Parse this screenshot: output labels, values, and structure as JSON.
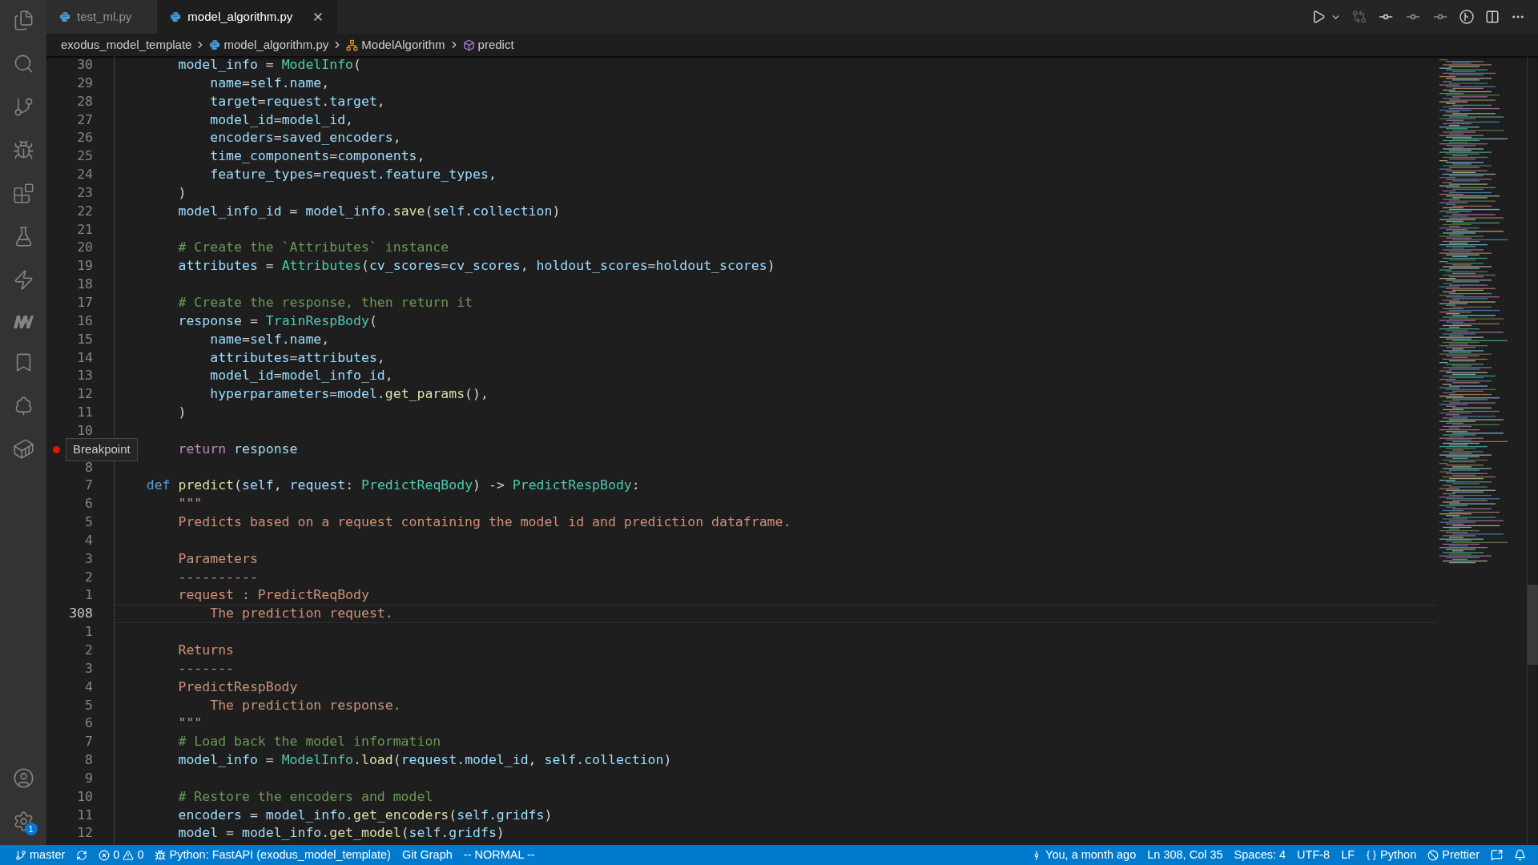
{
  "tabs": [
    {
      "label": "test_ml.py",
      "selected": false
    },
    {
      "label": "model_algorithm.py",
      "selected": true
    }
  ],
  "breadcrumbs": [
    {
      "kind": "folder",
      "label": "exodus_model_template"
    },
    {
      "kind": "file",
      "label": "model_algorithm.py"
    },
    {
      "kind": "class",
      "label": "ModelAlgorithm"
    },
    {
      "kind": "method",
      "label": "predict"
    }
  ],
  "activity_badge": "1",
  "tooltip": {
    "text": "Breakpoint"
  },
  "lines": [
    {
      "number": "30",
      "current": false,
      "breakpoint": false,
      "tokens": [
        {
          "kind": "var",
          "text": "        model_info"
        },
        {
          "kind": "punct",
          "text": " = "
        },
        {
          "kind": "class",
          "text": "ModelInfo"
        },
        {
          "kind": "punct",
          "text": "("
        }
      ]
    },
    {
      "number": "29",
      "current": false,
      "breakpoint": false,
      "tokens": [
        {
          "kind": "var",
          "text": "            name"
        },
        {
          "kind": "punct",
          "text": "="
        },
        {
          "kind": "var",
          "text": "self.name"
        },
        {
          "kind": "punct",
          "text": ","
        }
      ]
    },
    {
      "number": "28",
      "current": false,
      "breakpoint": false,
      "tokens": [
        {
          "kind": "var",
          "text": "            target"
        },
        {
          "kind": "punct",
          "text": "="
        },
        {
          "kind": "var",
          "text": "request.target"
        },
        {
          "kind": "punct",
          "text": ","
        }
      ]
    },
    {
      "number": "27",
      "current": false,
      "breakpoint": false,
      "tokens": [
        {
          "kind": "var",
          "text": "            model_id"
        },
        {
          "kind": "punct",
          "text": "="
        },
        {
          "kind": "var",
          "text": "model_id"
        },
        {
          "kind": "punct",
          "text": ","
        }
      ]
    },
    {
      "number": "26",
      "current": false,
      "breakpoint": false,
      "tokens": [
        {
          "kind": "var",
          "text": "            encoders"
        },
        {
          "kind": "punct",
          "text": "="
        },
        {
          "kind": "var",
          "text": "saved_encoders"
        },
        {
          "kind": "punct",
          "text": ","
        }
      ]
    },
    {
      "number": "25",
      "current": false,
      "breakpoint": false,
      "tokens": [
        {
          "kind": "var",
          "text": "            time_components"
        },
        {
          "kind": "punct",
          "text": "="
        },
        {
          "kind": "var",
          "text": "components"
        },
        {
          "kind": "punct",
          "text": ","
        }
      ]
    },
    {
      "number": "24",
      "current": false,
      "breakpoint": false,
      "tokens": [
        {
          "kind": "var",
          "text": "            feature_types"
        },
        {
          "kind": "punct",
          "text": "="
        },
        {
          "kind": "var",
          "text": "request.feature_types"
        },
        {
          "kind": "punct",
          "text": ","
        }
      ]
    },
    {
      "number": "23",
      "current": false,
      "breakpoint": false,
      "tokens": [
        {
          "kind": "punct",
          "text": "        )"
        }
      ]
    },
    {
      "number": "22",
      "current": false,
      "breakpoint": false,
      "tokens": [
        {
          "kind": "var",
          "text": "        model_info_id"
        },
        {
          "kind": "punct",
          "text": " = "
        },
        {
          "kind": "var",
          "text": "model_info."
        },
        {
          "kind": "func",
          "text": "save"
        },
        {
          "kind": "punct",
          "text": "("
        },
        {
          "kind": "var",
          "text": "self.collection"
        },
        {
          "kind": "punct",
          "text": ")"
        }
      ]
    },
    {
      "number": "21",
      "current": false,
      "breakpoint": false
    },
    {
      "number": "20",
      "current": false,
      "breakpoint": false,
      "tokens": [
        {
          "kind": "comment",
          "text": "        # Create the `Attributes` instance"
        }
      ]
    },
    {
      "number": "19",
      "current": false,
      "breakpoint": false,
      "tokens": [
        {
          "kind": "var",
          "text": "        attributes"
        },
        {
          "kind": "punct",
          "text": " = "
        },
        {
          "kind": "class",
          "text": "Attributes"
        },
        {
          "kind": "punct",
          "text": "("
        },
        {
          "kind": "var",
          "text": "cv_scores"
        },
        {
          "kind": "punct",
          "text": "="
        },
        {
          "kind": "var",
          "text": "cv_scores"
        },
        {
          "kind": "punct",
          "text": ", "
        },
        {
          "kind": "var",
          "text": "holdout_scores"
        },
        {
          "kind": "punct",
          "text": "="
        },
        {
          "kind": "var",
          "text": "holdout_scores"
        },
        {
          "kind": "punct",
          "text": ")"
        }
      ]
    },
    {
      "number": "18",
      "current": false,
      "breakpoint": false
    },
    {
      "number": "17",
      "current": false,
      "breakpoint": false,
      "tokens": [
        {
          "kind": "comment",
          "text": "        # Create the response, then return it"
        }
      ]
    },
    {
      "number": "16",
      "current": false,
      "breakpoint": false,
      "tokens": [
        {
          "kind": "var",
          "text": "        response"
        },
        {
          "kind": "punct",
          "text": " = "
        },
        {
          "kind": "class",
          "text": "TrainRespBody"
        },
        {
          "kind": "punct",
          "text": "("
        }
      ]
    },
    {
      "number": "15",
      "current": false,
      "breakpoint": false,
      "tokens": [
        {
          "kind": "var",
          "text": "            name"
        },
        {
          "kind": "punct",
          "text": "="
        },
        {
          "kind": "var",
          "text": "self.name"
        },
        {
          "kind": "punct",
          "text": ","
        }
      ]
    },
    {
      "number": "14",
      "current": false,
      "breakpoint": false,
      "tokens": [
        {
          "kind": "var",
          "text": "            attributes"
        },
        {
          "kind": "punct",
          "text": "="
        },
        {
          "kind": "var",
          "text": "attributes"
        },
        {
          "kind": "punct",
          "text": ","
        }
      ]
    },
    {
      "number": "13",
      "current": false,
      "breakpoint": false,
      "tokens": [
        {
          "kind": "var",
          "text": "            model_id"
        },
        {
          "kind": "punct",
          "text": "="
        },
        {
          "kind": "var",
          "text": "model_info_id"
        },
        {
          "kind": "punct",
          "text": ","
        }
      ]
    },
    {
      "number": "12",
      "current": false,
      "breakpoint": false,
      "tokens": [
        {
          "kind": "var",
          "text": "            hyperparameters"
        },
        {
          "kind": "punct",
          "text": "="
        },
        {
          "kind": "var",
          "text": "model."
        },
        {
          "kind": "func",
          "text": "get_params"
        },
        {
          "kind": "punct",
          "text": "(),"
        }
      ]
    },
    {
      "number": "11",
      "current": false,
      "breakpoint": false,
      "tokens": [
        {
          "kind": "punct",
          "text": "        )"
        }
      ]
    },
    {
      "number": "10",
      "current": false,
      "breakpoint": false
    },
    {
      "current": false,
      "breakpoint": true,
      "tokens": [
        {
          "kind": "control",
          "text": "        return"
        },
        {
          "kind": "var",
          "text": " response"
        }
      ]
    },
    {
      "number": "8",
      "current": false,
      "breakpoint": false
    },
    {
      "number": "7",
      "current": false,
      "breakpoint": false,
      "tokens": [
        {
          "kind": "keyword",
          "text": "    def"
        },
        {
          "kind": "func",
          "text": " predict"
        },
        {
          "kind": "punct",
          "text": "("
        },
        {
          "kind": "var",
          "text": "self"
        },
        {
          "kind": "punct",
          "text": ", "
        },
        {
          "kind": "var",
          "text": "request"
        },
        {
          "kind": "punct",
          "text": ": "
        },
        {
          "kind": "class",
          "text": "PredictReqBody"
        },
        {
          "kind": "punct",
          "text": ") -> "
        },
        {
          "kind": "class",
          "text": "PredictRespBody"
        },
        {
          "kind": "punct",
          "text": ":"
        }
      ]
    },
    {
      "number": "6",
      "current": false,
      "breakpoint": false,
      "tokens": [
        {
          "kind": "string",
          "text": "        \"\"\""
        }
      ]
    },
    {
      "number": "5",
      "current": false,
      "breakpoint": false,
      "tokens": [
        {
          "kind": "string",
          "text": "        Predicts based on a request containing the model id and prediction dataframe."
        }
      ]
    },
    {
      "number": "4",
      "current": false,
      "breakpoint": false
    },
    {
      "number": "3",
      "current": false,
      "breakpoint": false,
      "tokens": [
        {
          "kind": "string",
          "text": "        Parameters"
        }
      ]
    },
    {
      "number": "2",
      "current": false,
      "breakpoint": false,
      "tokens": [
        {
          "kind": "string",
          "text": "        ----------"
        }
      ]
    },
    {
      "number": "1",
      "current": false,
      "breakpoint": false,
      "tokens": [
        {
          "kind": "string",
          "text": "        request : PredictReqBody"
        }
      ]
    },
    {
      "number": "308",
      "current": true,
      "breakpoint": false,
      "tokens": [
        {
          "kind": "string",
          "text": "            The prediction request."
        }
      ]
    },
    {
      "number": "1",
      "current": false,
      "breakpoint": false
    },
    {
      "number": "2",
      "current": false,
      "breakpoint": false,
      "tokens": [
        {
          "kind": "string",
          "text": "        Returns"
        }
      ]
    },
    {
      "number": "3",
      "current": false,
      "breakpoint": false,
      "tokens": [
        {
          "kind": "string",
          "text": "        -------"
        }
      ]
    },
    {
      "number": "4",
      "current": false,
      "breakpoint": false,
      "tokens": [
        {
          "kind": "string",
          "text": "        PredictRespBody"
        }
      ]
    },
    {
      "number": "5",
      "current": false,
      "breakpoint": false,
      "tokens": [
        {
          "kind": "string",
          "text": "            The prediction response."
        }
      ]
    },
    {
      "number": "6",
      "current": false,
      "breakpoint": false,
      "tokens": [
        {
          "kind": "string",
          "text": "        \"\"\""
        }
      ]
    },
    {
      "number": "7",
      "current": false,
      "breakpoint": false,
      "tokens": [
        {
          "kind": "comment",
          "text": "        # Load back the model information"
        }
      ]
    },
    {
      "number": "8",
      "current": false,
      "breakpoint": false,
      "tokens": [
        {
          "kind": "var",
          "text": "        model_info"
        },
        {
          "kind": "punct",
          "text": " = "
        },
        {
          "kind": "class",
          "text": "ModelInfo"
        },
        {
          "kind": "punct",
          "text": "."
        },
        {
          "kind": "func",
          "text": "load"
        },
        {
          "kind": "punct",
          "text": "("
        },
        {
          "kind": "var",
          "text": "request.model_id"
        },
        {
          "kind": "punct",
          "text": ", "
        },
        {
          "kind": "var",
          "text": "self.collection"
        },
        {
          "kind": "punct",
          "text": ")"
        }
      ]
    },
    {
      "number": "9",
      "current": false,
      "breakpoint": false
    },
    {
      "number": "10",
      "current": false,
      "breakpoint": false,
      "tokens": [
        {
          "kind": "comment",
          "text": "        # Restore the encoders and model"
        }
      ]
    },
    {
      "number": "11",
      "current": false,
      "breakpoint": false,
      "tokens": [
        {
          "kind": "var",
          "text": "        encoders"
        },
        {
          "kind": "punct",
          "text": " = "
        },
        {
          "kind": "var",
          "text": "model_info."
        },
        {
          "kind": "func",
          "text": "get_encoders"
        },
        {
          "kind": "punct",
          "text": "("
        },
        {
          "kind": "var",
          "text": "self.gridfs"
        },
        {
          "kind": "punct",
          "text": ")"
        }
      ]
    },
    {
      "number": "12",
      "current": false,
      "breakpoint": false,
      "tokens": [
        {
          "kind": "var",
          "text": "        model"
        },
        {
          "kind": "punct",
          "text": " = "
        },
        {
          "kind": "var",
          "text": "model_info."
        },
        {
          "kind": "func",
          "text": "get_model"
        },
        {
          "kind": "punct",
          "text": "("
        },
        {
          "kind": "var",
          "text": "self.gridfs"
        },
        {
          "kind": "punct",
          "text": ")"
        }
      ]
    }
  ],
  "status_left": [
    {
      "kind": "branch",
      "label": "master"
    },
    {
      "kind": "sync"
    },
    {
      "kind": "problems",
      "errors": "0",
      "warnings": "0"
    },
    {
      "kind": "debug",
      "label": "Python: FastAPI (exodus_model_template)"
    },
    {
      "kind": "text",
      "label": "Git Graph"
    },
    {
      "kind": "text",
      "label": "-- NORMAL --"
    }
  ],
  "status_right": [
    {
      "kind": "commit",
      "label": "You, a month ago"
    },
    {
      "kind": "text",
      "label": "Ln 308, Col 35"
    },
    {
      "kind": "text",
      "label": "Spaces: 4"
    },
    {
      "kind": "text",
      "label": "UTF-8"
    },
    {
      "kind": "text",
      "label": "LF"
    },
    {
      "kind": "language",
      "label": "Python"
    },
    {
      "kind": "formatter",
      "label": "Prettier"
    },
    {
      "kind": "feedback"
    },
    {
      "kind": "bell"
    }
  ]
}
